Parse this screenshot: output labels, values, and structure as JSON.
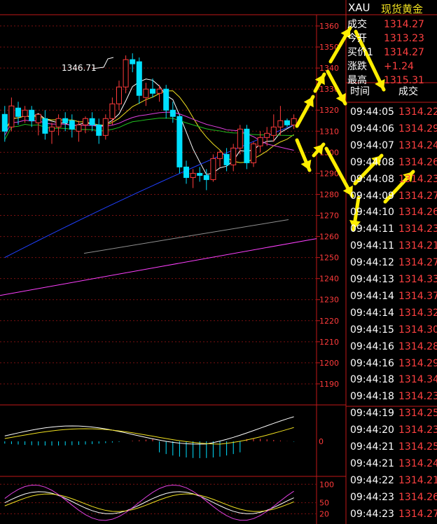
{
  "header": {
    "symbol": "XAU",
    "name": "现货黄金"
  },
  "quote": [
    {
      "label": "成交",
      "value": "1314.27"
    },
    {
      "label": "今开",
      "value": "1313.23"
    },
    {
      "label": "买价1",
      "value": "1314.27"
    },
    {
      "label": "涨跌",
      "value": "+1.24"
    },
    {
      "label": "最高",
      "value": "1315.31"
    }
  ],
  "ticks_header": {
    "time": "时间",
    "price": "成交"
  },
  "ticks": [
    {
      "time": "09:44:05",
      "price": "1314.22"
    },
    {
      "time": "09:44:06",
      "price": "1314.29"
    },
    {
      "time": "09:44:07",
      "price": "1314.24"
    },
    {
      "time": "09:44:08",
      "price": "1314.26"
    },
    {
      "time": "09:44:08",
      "price": "1314.23"
    },
    {
      "time": "09:44:09",
      "price": "1314.27"
    },
    {
      "time": "09:44:10",
      "price": "1314.26"
    },
    {
      "time": "09:44:11",
      "price": "1314.23"
    },
    {
      "time": "09:44:11",
      "price": "1314.21"
    },
    {
      "time": "09:44:12",
      "price": "1314.27"
    },
    {
      "time": "09:44:13",
      "price": "1314.33"
    },
    {
      "time": "09:44:14",
      "price": "1314.37"
    },
    {
      "time": "09:44:14",
      "price": "1314.32"
    },
    {
      "time": "09:44:15",
      "price": "1314.30"
    },
    {
      "time": "09:44:16",
      "price": "1314.28"
    },
    {
      "time": "09:44:16",
      "price": "1314.29"
    },
    {
      "time": "09:44:18",
      "price": "1314.34"
    },
    {
      "time": "09:44:18",
      "price": "1314.23"
    },
    {
      "time": "09:44:19",
      "price": "1314.25"
    },
    {
      "time": "09:44:20",
      "price": "1314.23"
    },
    {
      "time": "09:44:21",
      "price": "1314.25"
    },
    {
      "time": "09:44:21",
      "price": "1314.24"
    },
    {
      "time": "09:44:22",
      "price": "1314.21"
    },
    {
      "time": "09:44:23",
      "price": "1314.26"
    },
    {
      "time": "09:44:23",
      "price": "1314.27"
    }
  ],
  "chart_data": {
    "type": "candlestick",
    "ylim": [
      1180,
      1365
    ],
    "yticks": [
      1360,
      1350,
      1340,
      1330,
      1320,
      1310,
      1300,
      1290,
      1280,
      1270,
      1260,
      1250,
      1240,
      1230,
      1220,
      1210,
      1200,
      1190
    ],
    "annotation": {
      "text": "1346.71",
      "value": 1346.71
    },
    "candles": [
      {
        "o": 1318,
        "h": 1322,
        "l": 1305,
        "c": 1310
      },
      {
        "o": 1312,
        "h": 1326,
        "l": 1310,
        "c": 1322
      },
      {
        "o": 1321,
        "h": 1324,
        "l": 1313,
        "c": 1317
      },
      {
        "o": 1317,
        "h": 1322,
        "l": 1314,
        "c": 1320
      },
      {
        "o": 1320,
        "h": 1322,
        "l": 1312,
        "c": 1315
      },
      {
        "o": 1314,
        "h": 1318,
        "l": 1308,
        "c": 1318
      },
      {
        "o": 1316,
        "h": 1320,
        "l": 1306,
        "c": 1309
      },
      {
        "o": 1310,
        "h": 1314,
        "l": 1304,
        "c": 1312
      },
      {
        "o": 1312,
        "h": 1318,
        "l": 1308,
        "c": 1316
      },
      {
        "o": 1316,
        "h": 1319,
        "l": 1310,
        "c": 1314
      },
      {
        "o": 1315,
        "h": 1318,
        "l": 1307,
        "c": 1311
      },
      {
        "o": 1310,
        "h": 1315,
        "l": 1305,
        "c": 1313
      },
      {
        "o": 1313,
        "h": 1317,
        "l": 1309,
        "c": 1316
      },
      {
        "o": 1316,
        "h": 1319,
        "l": 1310,
        "c": 1313
      },
      {
        "o": 1313,
        "h": 1316,
        "l": 1304,
        "c": 1308
      },
      {
        "o": 1308,
        "h": 1318,
        "l": 1306,
        "c": 1316
      },
      {
        "o": 1316,
        "h": 1326,
        "l": 1313,
        "c": 1323
      },
      {
        "o": 1323,
        "h": 1334,
        "l": 1320,
        "c": 1331
      },
      {
        "o": 1331,
        "h": 1346,
        "l": 1328,
        "c": 1344
      },
      {
        "o": 1344,
        "h": 1347,
        "l": 1338,
        "c": 1342
      },
      {
        "o": 1343,
        "h": 1345,
        "l": 1323,
        "c": 1327
      },
      {
        "o": 1326,
        "h": 1333,
        "l": 1322,
        "c": 1330
      },
      {
        "o": 1330,
        "h": 1335,
        "l": 1326,
        "c": 1328
      },
      {
        "o": 1328,
        "h": 1332,
        "l": 1324,
        "c": 1330
      },
      {
        "o": 1330,
        "h": 1332,
        "l": 1316,
        "c": 1320
      },
      {
        "o": 1320,
        "h": 1324,
        "l": 1314,
        "c": 1317
      },
      {
        "o": 1317,
        "h": 1318,
        "l": 1290,
        "c": 1293
      },
      {
        "o": 1293,
        "h": 1296,
        "l": 1285,
        "c": 1288
      },
      {
        "o": 1288,
        "h": 1292,
        "l": 1283,
        "c": 1290
      },
      {
        "o": 1290,
        "h": 1293,
        "l": 1286,
        "c": 1289
      },
      {
        "o": 1289,
        "h": 1292,
        "l": 1282,
        "c": 1287
      },
      {
        "o": 1287,
        "h": 1299,
        "l": 1286,
        "c": 1297
      },
      {
        "o": 1297,
        "h": 1301,
        "l": 1293,
        "c": 1300
      },
      {
        "o": 1299,
        "h": 1302,
        "l": 1291,
        "c": 1294
      },
      {
        "o": 1294,
        "h": 1304,
        "l": 1291,
        "c": 1302
      },
      {
        "o": 1302,
        "h": 1313,
        "l": 1299,
        "c": 1311
      },
      {
        "o": 1311,
        "h": 1313,
        "l": 1292,
        "c": 1295
      },
      {
        "o": 1295,
        "h": 1305,
        "l": 1293,
        "c": 1304
      },
      {
        "o": 1303,
        "h": 1310,
        "l": 1300,
        "c": 1307
      },
      {
        "o": 1307,
        "h": 1312,
        "l": 1303,
        "c": 1309
      },
      {
        "o": 1308,
        "h": 1318,
        "l": 1305,
        "c": 1312
      },
      {
        "o": 1312,
        "h": 1322,
        "l": 1308,
        "c": 1315
      },
      {
        "o": 1315,
        "h": 1316,
        "l": 1312,
        "c": 1313
      },
      {
        "o": 1313,
        "h": 1318,
        "l": 1311,
        "c": 1316
      }
    ],
    "macd": {
      "ylim": [
        -15,
        15
      ],
      "zero_label": "0"
    },
    "kdj": {
      "ylim": [
        0,
        110
      ],
      "ticks": [
        100,
        50,
        20
      ],
      "tick_labels": [
        "100",
        "50",
        "20"
      ]
    }
  }
}
